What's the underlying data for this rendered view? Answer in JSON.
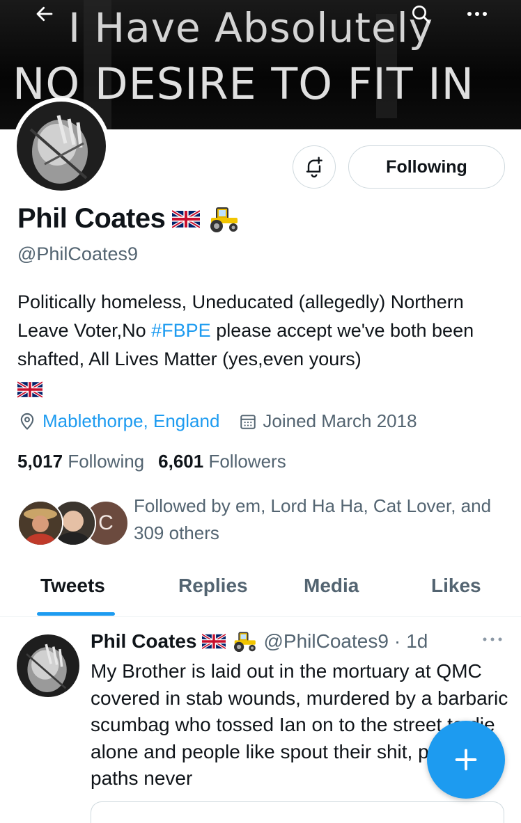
{
  "banner": {
    "line1": "I Have Absolutely",
    "line2": "NO DESIRE TO FIT IN"
  },
  "profile": {
    "name": "Phil Coates",
    "name_emojis": [
      "uk-flag",
      "tractor"
    ],
    "handle": "@PhilCoates9",
    "bio_part1": "Politically homeless, Uneducated (allegedly) Northern Leave Voter,No ",
    "bio_hashtag": "#FBPE",
    "bio_part2": " please accept we've both been shafted, All Lives Matter (yes,even yours)",
    "location": "Mablethorpe, England",
    "joined": "Joined March 2018",
    "following_count": "5,017",
    "following_label": "Following",
    "followers_count": "6,601",
    "followers_label": "Followers",
    "followed_by": "Followed by em, Lord Ha Ha, Cat Lover, and 309 others",
    "followed_by_avatar_letter": "C"
  },
  "actions": {
    "following_button": "Following"
  },
  "tabs": [
    {
      "label": "Tweets",
      "active": true
    },
    {
      "label": "Replies",
      "active": false
    },
    {
      "label": "Media",
      "active": false
    },
    {
      "label": "Likes",
      "active": false
    }
  ],
  "tweet": {
    "author": "Phil Coates",
    "handle": "@PhilCoates9",
    "separator": "·",
    "time": "1d",
    "text": "My Brother is laid out in the mortuary at QMC covered in stab wounds, murdered by a barbaric scumbag who tossed Ian on to the street to die alone and people like spout their shit, pray our paths never"
  },
  "colors": {
    "accent": "#1d9bf0",
    "secondary_text": "#536471",
    "primary_text": "#0f1419",
    "border": "#cfd9de"
  }
}
